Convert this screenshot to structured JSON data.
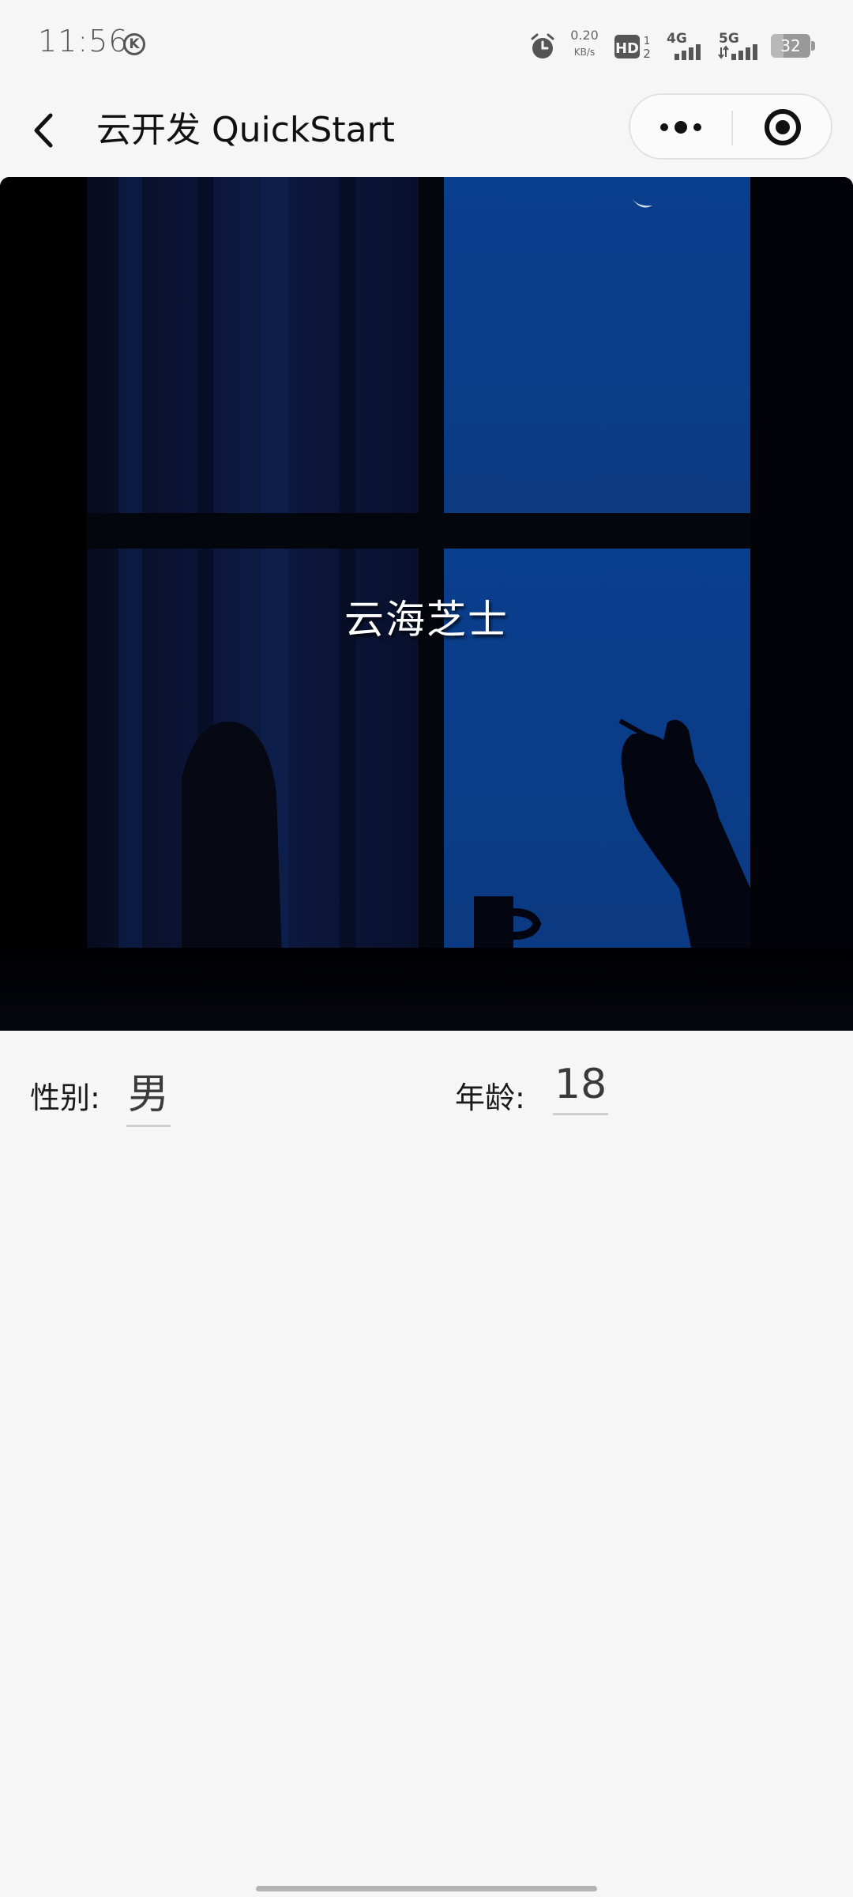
{
  "status_bar": {
    "time": "11:56",
    "k_badge": "K",
    "net_speed_value": "0.20",
    "net_speed_unit": "KB/s",
    "hd_label": "HD",
    "sim_labels": [
      "1",
      "2"
    ],
    "net_4g": "4G",
    "net_5g": "5G",
    "battery_level": "32",
    "icons": [
      "alarm-icon",
      "hd-voice-icon",
      "signal-4g-icon",
      "signal-5g-icon",
      "battery-icon"
    ]
  },
  "nav_bar": {
    "back_icon": "chevron-left-icon",
    "title": "云开发 QuickStart",
    "more_icon": "more-dots-icon",
    "close_icon": "target-circle-icon"
  },
  "profile": {
    "name": "云海芝士",
    "gender_label": "性别:",
    "gender_value": "男",
    "age_label": "年龄:",
    "age_value": "18"
  },
  "colors": {
    "background": "#f6f6f6",
    "cover_dark": "#000000",
    "window_blue": "#0c3a82",
    "text": "#1a1a1a"
  }
}
